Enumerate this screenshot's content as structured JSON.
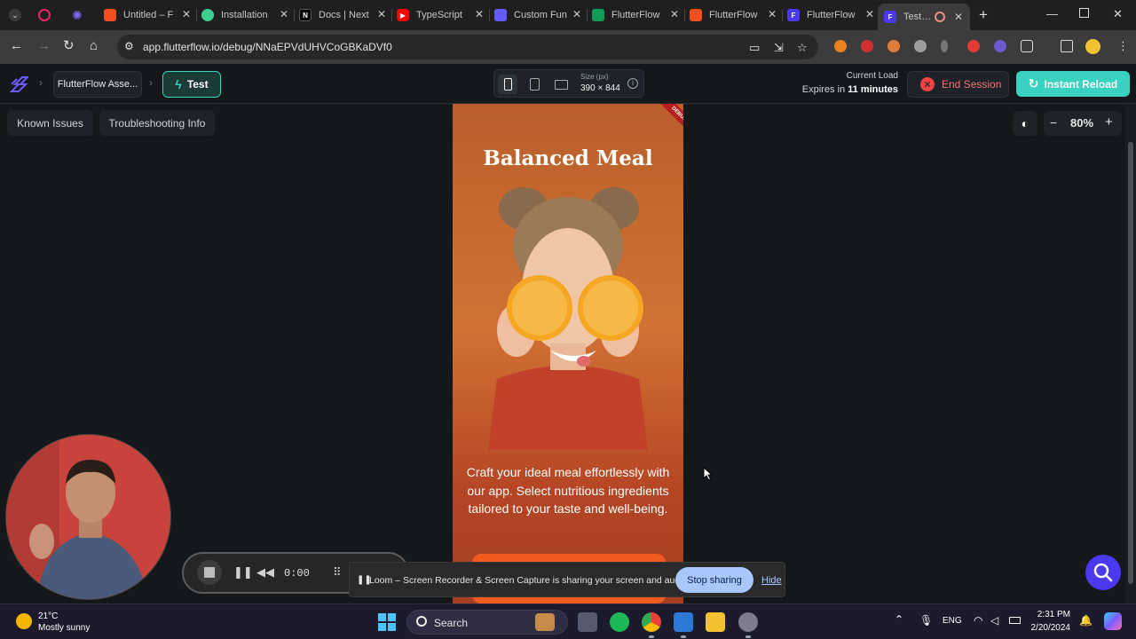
{
  "browser": {
    "tabs": [
      {
        "label": "Untitled – F",
        "favicon": "figma-icon",
        "color": "#f24e1e"
      },
      {
        "label": "Installation",
        "favicon": "shadcn-icon",
        "color": "#3ecf8e"
      },
      {
        "label": "Docs | Next",
        "favicon": "nextjs-icon",
        "color": "#000000"
      },
      {
        "label": "TypeScript",
        "favicon": "youtube-icon",
        "color": "#ff0000"
      },
      {
        "label": "Custom Fun",
        "favicon": "stripe-icon",
        "color": "#635bff"
      },
      {
        "label": "FlutterFlow",
        "favicon": "sheets-icon",
        "color": "#0f9d58"
      },
      {
        "label": "FlutterFlow",
        "favicon": "figma-icon",
        "color": "#f24e1e"
      },
      {
        "label": "FlutterFlow",
        "favicon": "flutterflow-icon",
        "color": "#4b39ef"
      },
      {
        "label": "Test Mo",
        "favicon": "flutterflow-icon",
        "color": "#4b39ef"
      }
    ],
    "url": "app.flutterflow.io/debug/NNaEPVdUHVCoGBKaDVf0"
  },
  "header": {
    "project": "FlutterFlow Asse...",
    "test_label": "Test",
    "size_label": "Size (px)",
    "size_value": "390 × 844",
    "load_title": "Current Load",
    "expires_prefix": "Expires in",
    "expires_value": "11 minutes",
    "end_session": "End Session",
    "instant_reload": "Instant Reload"
  },
  "toolbar": {
    "known_issues": "Known Issues",
    "troubleshooting": "Troubleshooting Info",
    "zoom": "80%",
    "zoom_minus": "−",
    "zoom_plus": "+"
  },
  "phone": {
    "debug_badge": "DEBUG",
    "title": "Balanced Meal",
    "body": "Craft your ideal meal effortlessly with our app. Select nutritious ingredients tailored to your taste and well-being."
  },
  "loom": {
    "time": "0:00",
    "share_text": "Loom – Screen Recorder & Screen Capture is sharing your screen and audio.",
    "stop_sharing": "Stop sharing",
    "hide": "Hide"
  },
  "taskbar": {
    "temp": "21°C",
    "condition": "Mostly sunny",
    "search": "Search",
    "lang": "ENG",
    "time": "2:31 PM",
    "date": "2/20/2024"
  },
  "colors": {
    "accent_teal": "#39d2c0",
    "accent_purple": "#4b39ef",
    "danger": "#ef4444",
    "app_bg": "#14181b"
  }
}
